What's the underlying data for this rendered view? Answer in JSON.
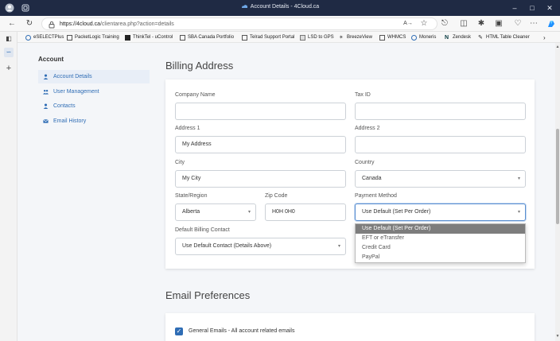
{
  "window": {
    "title": "Account Details - 4Cloud.ca",
    "url_host": "https://4cloud.ca",
    "url_path": "/clientarea.php?action=details"
  },
  "bookmarks": [
    "eSELECTPlus",
    "PacketLogic Training",
    "ThinkTel - uControl",
    "SBA Canada Portfolio",
    "Telrad Support Portal",
    "LSD to GPS",
    "BreezeView",
    "WHMCS",
    "Moneris",
    "Zendesk",
    "HTML Table Cleaner"
  ],
  "sidebar": {
    "title": "Account",
    "items": [
      {
        "label": "Account Details",
        "icon": "user-icon"
      },
      {
        "label": "User Management",
        "icon": "users-icon"
      },
      {
        "label": "Contacts",
        "icon": "contact-icon"
      },
      {
        "label": "Email History",
        "icon": "envelope-icon"
      }
    ]
  },
  "billing": {
    "heading": "Billing Address",
    "company_label": "Company Name",
    "company_value": "",
    "tax_label": "Tax ID",
    "tax_value": "",
    "address1_label": "Address 1",
    "address1_value": "My Address",
    "address2_label": "Address 2",
    "address2_value": "",
    "city_label": "City",
    "city_value": "My City",
    "country_label": "Country",
    "country_value": "Canada",
    "state_label": "State/Region",
    "state_value": "Alberta",
    "zip_label": "Zip Code",
    "zip_value": "H0H 0H0",
    "payment_label": "Payment Method",
    "payment_value": "Use Default (Set Per Order)",
    "contact_label": "Default Billing Contact",
    "contact_value": "Use Default Contact (Details Above)",
    "payment_options": [
      "Use Default (Set Per Order)",
      "EFT or eTransfer",
      "Credit Card",
      "PayPal"
    ]
  },
  "email": {
    "heading": "Email Preferences",
    "general_label": "General Emails - All account related emails"
  },
  "colors": {
    "accent": "#2f6db5",
    "titlebar": "#1f2a44"
  }
}
